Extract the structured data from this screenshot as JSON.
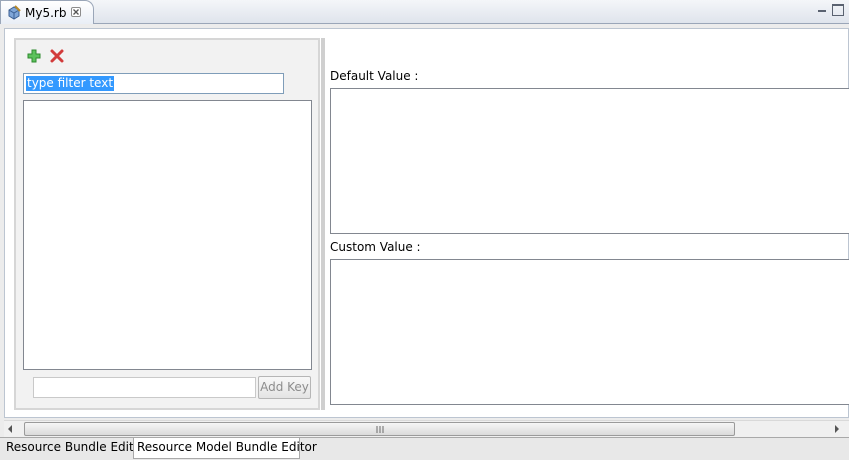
{
  "editor_tab": {
    "title": "My5.rb",
    "icon": "ruby-file-icon",
    "close_icon": "close-icon"
  },
  "window_controls": [
    "minimize-icon",
    "maximize-icon"
  ],
  "left_panel": {
    "toolbar": [
      {
        "name": "add-key-toolbar-button",
        "icon": "green-plus-icon",
        "color": "#3aa23a"
      },
      {
        "name": "delete-key-toolbar-button",
        "icon": "red-x-icon",
        "color": "#d23b3b"
      }
    ],
    "filter_value": "type filter text",
    "new_key_value": "",
    "add_key_label": "Add Key",
    "keys": []
  },
  "right_panel": {
    "default_label": "Default Value :",
    "default_value": "",
    "custom_label": "Custom Value :",
    "custom_value": ""
  },
  "scrollbar": {
    "grip_label": "III"
  },
  "page_tabs": [
    {
      "label": "Resource Bundle Editor",
      "active": false
    },
    {
      "label": "Resource Model Bundle Editor",
      "active": true
    }
  ],
  "colors": {
    "selection": "#3399ff",
    "input_border": "#7f9db9",
    "tab_border": "#9aa6b8"
  }
}
